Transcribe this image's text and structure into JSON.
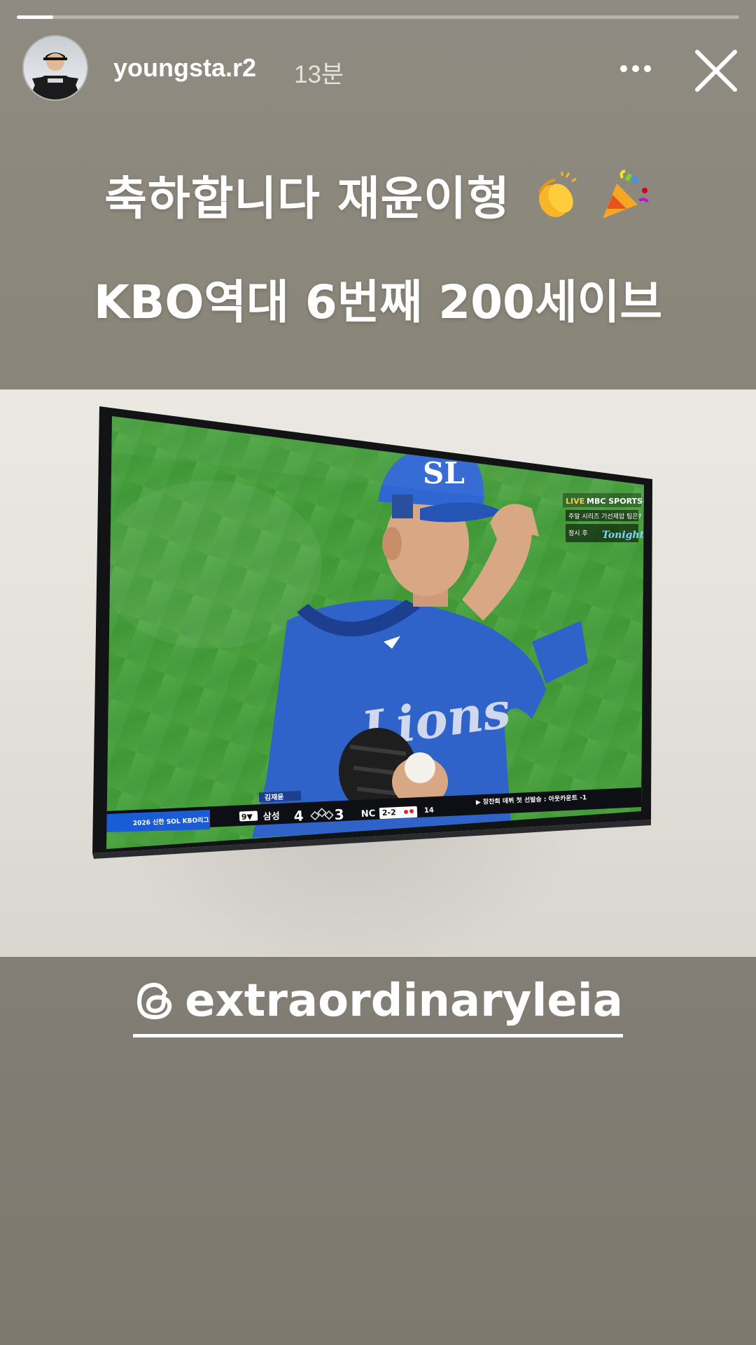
{
  "story": {
    "progress": 0.05,
    "username": "youngsta.r2",
    "timestamp": "13분",
    "caption_line1": "축하합니다 재윤이형",
    "caption_line2": "KBO역대 6번째 200세이브",
    "mention": "extraordinaryleia"
  },
  "tv": {
    "broadcaster_live": "LIVE",
    "broadcaster": "MBC SPORTS+",
    "promo_line1": "주말 시리즈 기선제압 팀은?",
    "promo_line2": "정시 후",
    "promo_brand": "Tonight",
    "league_label": "2026 신한 SOL KBO리그",
    "inning": "9▼",
    "team_home": "삼성",
    "score_home": "4",
    "score_away": "3",
    "team_away": "NC",
    "count": "2-2",
    "pitch_count": "14",
    "ticker": "▶ 장찬희 데뷔 첫 선발승 : 아웃카운트 -1",
    "player_name": "김재윤"
  },
  "icons": {
    "more": "more-horizontal-icon",
    "close": "close-icon",
    "threads": "threads-icon",
    "clap": "clapping-hands-emoji",
    "party": "party-popper-emoji"
  },
  "colors": {
    "background": "#85817a",
    "text": "#ffffff",
    "jersey_blue": "#2f63c9",
    "field_green": "#4ea23f"
  }
}
